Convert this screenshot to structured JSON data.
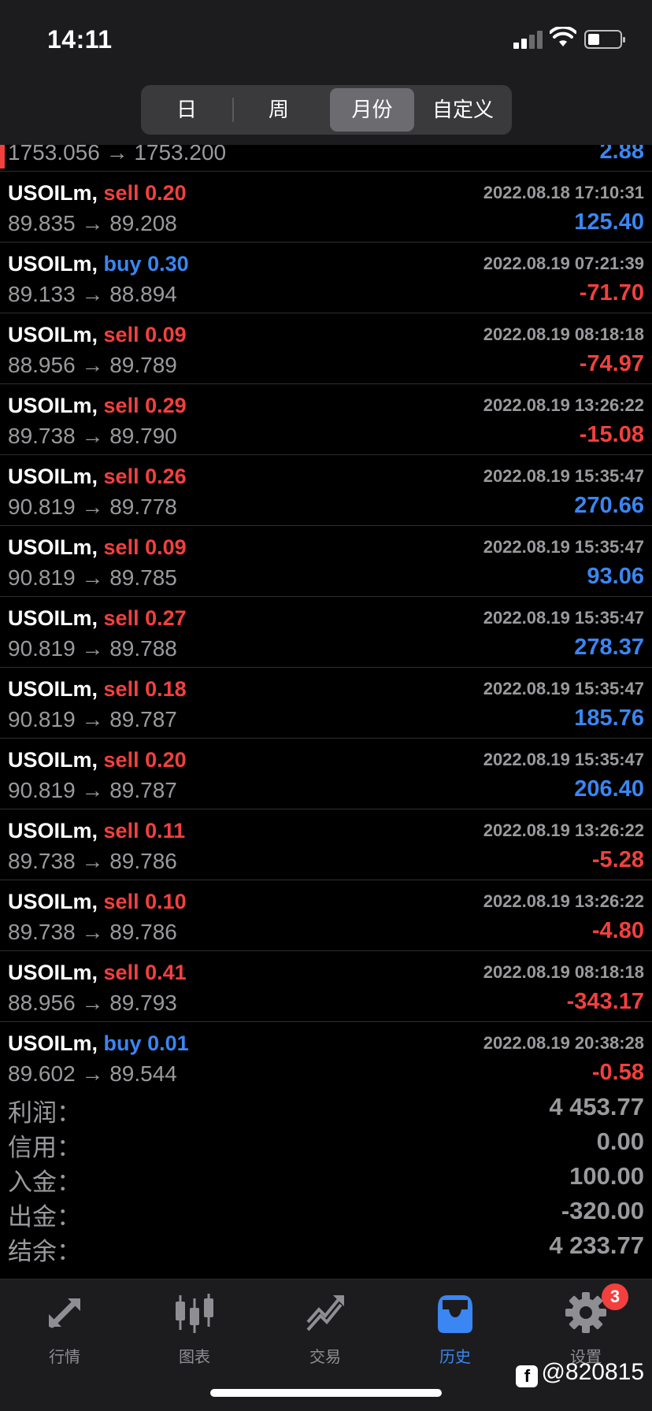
{
  "status_bar": {
    "time": "14:11"
  },
  "period_tabs": [
    {
      "label": "日",
      "active": false
    },
    {
      "label": "周",
      "active": false
    },
    {
      "label": "月份",
      "active": true
    },
    {
      "label": "自定义",
      "active": false
    }
  ],
  "partial_row": {
    "prices": "1753.056 → 1753.200",
    "profit": "2.88"
  },
  "trades": [
    {
      "symbol": "USOILm,",
      "side": "sell",
      "volume": "0.20",
      "date": "2022.08.18 17:10:31",
      "prices": "89.835 → 89.208",
      "profit": "125.40"
    },
    {
      "symbol": "USOILm,",
      "side": "buy",
      "volume": "0.30",
      "date": "2022.08.19 07:21:39",
      "prices": "89.133 → 88.894",
      "profit": "-71.70"
    },
    {
      "symbol": "USOILm,",
      "side": "sell",
      "volume": "0.09",
      "date": "2022.08.19 08:18:18",
      "prices": "88.956 → 89.789",
      "profit": "-74.97"
    },
    {
      "symbol": "USOILm,",
      "side": "sell",
      "volume": "0.29",
      "date": "2022.08.19 13:26:22",
      "prices": "89.738 → 89.790",
      "profit": "-15.08"
    },
    {
      "symbol": "USOILm,",
      "side": "sell",
      "volume": "0.26",
      "date": "2022.08.19 15:35:47",
      "prices": "90.819 → 89.778",
      "profit": "270.66"
    },
    {
      "symbol": "USOILm,",
      "side": "sell",
      "volume": "0.09",
      "date": "2022.08.19 15:35:47",
      "prices": "90.819 → 89.785",
      "profit": "93.06"
    },
    {
      "symbol": "USOILm,",
      "side": "sell",
      "volume": "0.27",
      "date": "2022.08.19 15:35:47",
      "prices": "90.819 → 89.788",
      "profit": "278.37"
    },
    {
      "symbol": "USOILm,",
      "side": "sell",
      "volume": "0.18",
      "date": "2022.08.19 15:35:47",
      "prices": "90.819 → 89.787",
      "profit": "185.76"
    },
    {
      "symbol": "USOILm,",
      "side": "sell",
      "volume": "0.20",
      "date": "2022.08.19 15:35:47",
      "prices": "90.819 → 89.787",
      "profit": "206.40"
    },
    {
      "symbol": "USOILm,",
      "side": "sell",
      "volume": "0.11",
      "date": "2022.08.19 13:26:22",
      "prices": "89.738 → 89.786",
      "profit": "-5.28"
    },
    {
      "symbol": "USOILm,",
      "side": "sell",
      "volume": "0.10",
      "date": "2022.08.19 13:26:22",
      "prices": "89.738 → 89.786",
      "profit": "-4.80"
    },
    {
      "symbol": "USOILm,",
      "side": "sell",
      "volume": "0.41",
      "date": "2022.08.19 08:18:18",
      "prices": "88.956 → 89.793",
      "profit": "-343.17"
    },
    {
      "symbol": "USOILm,",
      "side": "buy",
      "volume": "0.01",
      "date": "2022.08.19 20:38:28",
      "prices": "89.602 → 89.544",
      "profit": "-0.58"
    }
  ],
  "summary": [
    {
      "label": "利润：",
      "value": "4 453.77"
    },
    {
      "label": "信用：",
      "value": "0.00"
    },
    {
      "label": "入金：",
      "value": "100.00"
    },
    {
      "label": "出金：",
      "value": "-320.00"
    },
    {
      "label": "结余：",
      "value": "4 233.77"
    }
  ],
  "tabbar": [
    {
      "label": "行情",
      "icon": "quotes-arrows-icon",
      "active": false
    },
    {
      "label": "图表",
      "icon": "candlestick-chart-icon",
      "active": false
    },
    {
      "label": "交易",
      "icon": "trade-trend-icon",
      "active": false
    },
    {
      "label": "历史",
      "icon": "history-inbox-icon",
      "active": true
    },
    {
      "label": "设置",
      "icon": "gear-icon",
      "active": false
    }
  ],
  "settings_badge": "3",
  "watermark": "@820815",
  "colors": {
    "sell": "#f2403f",
    "buy": "#3a86f2",
    "positive": "#3a86f2",
    "negative": "#f2403f",
    "active_tab": "#3a86f2"
  }
}
